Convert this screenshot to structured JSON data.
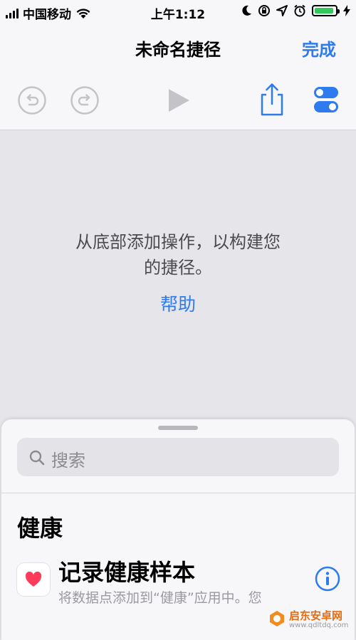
{
  "status_bar": {
    "carrier": "中国移动",
    "time": "上午1:12"
  },
  "nav": {
    "title": "未命名捷径",
    "done": "完成"
  },
  "toolbar": {
    "icons": [
      "undo-icon",
      "redo-icon",
      "play-icon",
      "share-icon",
      "settings-toggle-icon"
    ]
  },
  "empty_state": {
    "line1": "从底部添加操作，以构建您",
    "line2": "的捷径。",
    "help": "帮助"
  },
  "sheet": {
    "search_placeholder": "搜索",
    "section": "健康",
    "action": {
      "title": "记录健康样本",
      "subtitle": "将数据点添加到“健康”应用中。您"
    }
  },
  "watermark": {
    "name": "启东安卓网",
    "url": "www.qdltdq.com"
  },
  "colors": {
    "accent": "#2e7bf0",
    "battery": "#34c759",
    "heart": "#ff3b5c"
  }
}
